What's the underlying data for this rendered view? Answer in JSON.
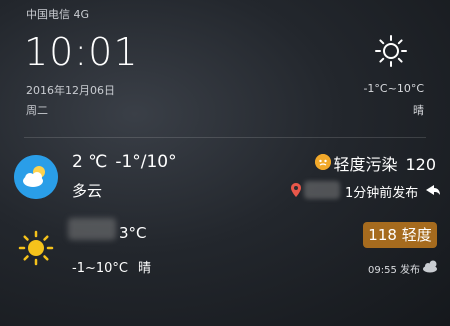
{
  "status_bar": {
    "carrier": "中国电信 4G"
  },
  "clock": {
    "time": "10:01",
    "date": "2016年12月06日",
    "weekday": "周二"
  },
  "header_weather": {
    "icon": "sun-icon",
    "range": "-1°C~10°C",
    "condition": "晴"
  },
  "current": {
    "icon": "partly-cloudy-icon",
    "temp": "2 ℃",
    "range": "-1°/10°",
    "condition": "多云",
    "air_quality_label": "轻度污染",
    "air_quality_value": "120",
    "published": "1分钟前发布"
  },
  "second": {
    "icon": "sun-icon",
    "temp": "3°C",
    "range": "-1~10°C",
    "condition": "晴",
    "aqi_badge": "118 轻度",
    "published": "09:55 发布"
  },
  "colors": {
    "badge_blue": "#2a9ee8",
    "aqi_orange": "#f1a82a",
    "aqi_badge_brown": "#a66b1e",
    "sun_yellow": "#f5c21b"
  }
}
